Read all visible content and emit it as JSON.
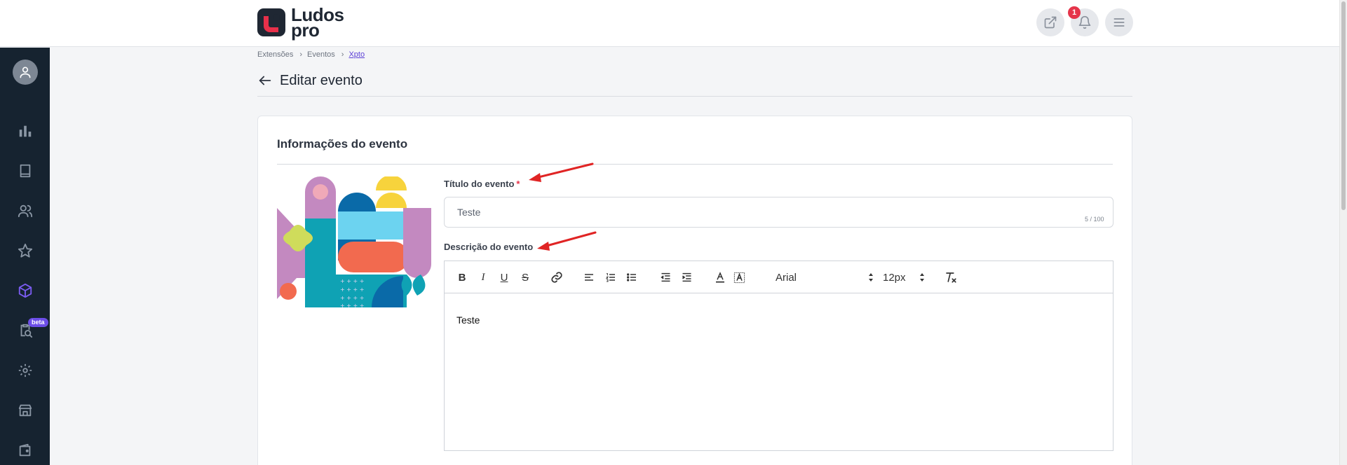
{
  "app": {
    "logo_line1": "Ludos",
    "logo_line2": "pro",
    "notification_count": "1"
  },
  "colors": {
    "accent": "#6d4ee8",
    "sidebar_bg": "#162330",
    "required": "#e5344a",
    "annotation_arrow": "#e02424"
  },
  "sidebar": {
    "items": [
      {
        "name": "avatar",
        "icon": "user-icon"
      },
      {
        "name": "dashboard",
        "icon": "bar-chart-icon"
      },
      {
        "name": "courses",
        "icon": "book-icon"
      },
      {
        "name": "users",
        "icon": "users-icon"
      },
      {
        "name": "favorites",
        "icon": "star-icon"
      },
      {
        "name": "extensions",
        "icon": "box-icon",
        "active": true
      },
      {
        "name": "search",
        "icon": "search-clipboard-icon",
        "badge": "beta"
      },
      {
        "name": "settings",
        "icon": "gear-icon"
      },
      {
        "name": "store",
        "icon": "store-icon"
      },
      {
        "name": "wallet",
        "icon": "wallet-icon"
      }
    ]
  },
  "breadcrumb": {
    "items": [
      "Extensões",
      "Eventos",
      "Xpto"
    ]
  },
  "page": {
    "title": "Editar evento"
  },
  "form": {
    "section_title": "Informações do evento",
    "title_label": "Título do evento",
    "title_required": "*",
    "title_value": "Teste",
    "title_counter": "5 / 100",
    "description_label": "Descrição do evento",
    "description_value": "Teste",
    "toolbar": {
      "buttons": [
        "bold",
        "italic",
        "underline",
        "strikethrough",
        "link",
        "align-left",
        "ordered-list",
        "bullet-list",
        "outdent",
        "indent",
        "font-color",
        "highlight-color",
        "clear-format"
      ],
      "font_family": "Arial",
      "font_size": "12px"
    }
  }
}
